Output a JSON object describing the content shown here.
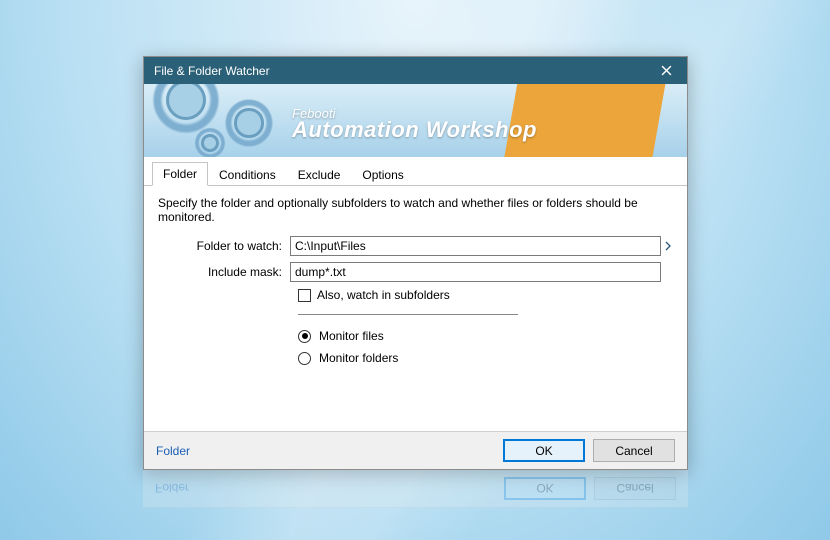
{
  "title": "File & Folder Watcher",
  "banner": {
    "brand": "Febooti",
    "product": "Automation Workshop"
  },
  "tabs": [
    {
      "label": "Folder",
      "active": true
    },
    {
      "label": "Conditions",
      "active": false
    },
    {
      "label": "Exclude",
      "active": false
    },
    {
      "label": "Options",
      "active": false
    }
  ],
  "description": "Specify the folder and optionally subfolders to watch and whether files or folders should be monitored.",
  "fields": {
    "folder_label": "Folder to watch:",
    "folder_value": "C:\\Input\\Files",
    "mask_label": "Include mask:",
    "mask_value": "dump*.txt",
    "subfolders_label": "Also, watch in subfolders",
    "subfolders_checked": false
  },
  "monitor": {
    "files_label": "Monitor files",
    "folders_label": "Monitor folders",
    "selected": "files"
  },
  "footer": {
    "help_link": "Folder",
    "ok": "OK",
    "cancel": "Cancel"
  }
}
